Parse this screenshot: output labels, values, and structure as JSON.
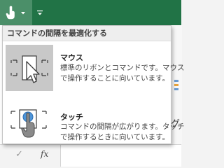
{
  "colors": {
    "titlebar": "#217346",
    "selected_option_bg": "#c8c8c8",
    "header_bg": "#eeeeee"
  },
  "quick_access": {
    "touch_mode_button": {
      "icon": "touch-mode-icon"
    },
    "customize_button": {
      "icon": "customize-qat-icon"
    }
  },
  "dropdown": {
    "header": "コマンドの間隔を最適化する",
    "options": [
      {
        "title": "マウス",
        "desc_lines": [
          "標準のリボンとコマンドです。マウス",
          "で操作することに向いています。"
        ],
        "icon": "mouse-mode-icon",
        "selected": true
      },
      {
        "title": "タッチ",
        "desc_lines": [
          "コマンドの間隔が広がります。タッチ",
          "で操作するときに向いています。"
        ],
        "icon": "touch-mode-icon",
        "selected": false
      }
    ]
  },
  "formula_bar": {
    "enter_symbol": "✓",
    "fx_label": "fx"
  },
  "sheet": {
    "partial_letter": "グ"
  }
}
